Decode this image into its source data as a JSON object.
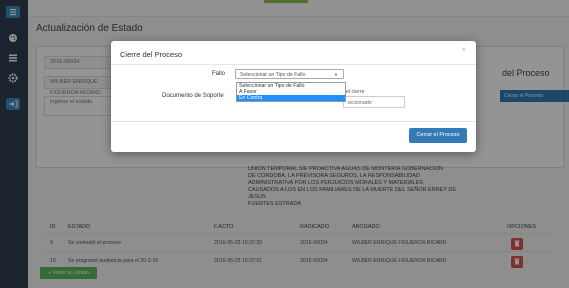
{
  "sidebar": {
    "icons": [
      "menu-icon",
      "palette-icon",
      "list-icon",
      "gear-icon",
      "sign-in-icon"
    ]
  },
  "page": {
    "title": "Actualización de Estado"
  },
  "background_form": {
    "field_1": "2016-00034",
    "field_2": "WILBER ENRIQUE FIGUEROA RICARD",
    "state_placeholder": "Ingrese el estado",
    "side_title": "del Proceso",
    "side_button": "Cerrar el Proceso"
  },
  "description": "UNION TEMPORAL SIE PROACTIVA AGUAS DE MONTERIA GOBERNACION\nDE CORDOBA, LA PREVISORA SEGUROS, LA RESPONSABILIDAD\nADMINISTRATIVA POR LOS PERJUICIOS MORALES Y MATERIALES\nCAUSADOS A LOS EN LOS FAMILIARES DE LA MUERTE DEL SEÑOR ERNEY DE JESUS\nFUERTES ESTRADA",
  "table": {
    "headers": [
      "ID",
      "ESTADO",
      "F.ACTO",
      "RADICADO",
      "ABOGADO",
      "OPCIONES"
    ],
    "rows": [
      {
        "id": "9",
        "estado": "Se contestó el proceso",
        "fecha": "2016-05-25 10:37:20",
        "radicado": "2016-00034",
        "abogado": "WILBER ENRIQUE FIGUEROA RICARD"
      },
      {
        "id": "10",
        "estado": "Se programó audiencia para el 20-2-16",
        "fecha": "2016-05-25 10:37:51",
        "radicado": "2016-00034",
        "abogado": "WILBER ENRIQUE FIGUEROA RICARD"
      }
    ]
  },
  "add_button": "+ Volver al Listado",
  "modal": {
    "title": "Cierre del Proceso",
    "close": "×",
    "fallo_label": "Fallo",
    "select_value": "Seleccionar un Tipo de Fallo",
    "options": [
      "Seleccionar un Tipo de Fallo",
      "A Favor",
      "En Contra"
    ],
    "selected_option": "En Contra",
    "doc_label": "Documento de Soporte",
    "doc_text": "el cierre",
    "doc_input": "eccionado",
    "submit_button": "Cerrar el Proceso"
  },
  "colors": {
    "sidebar": "#2f3d50",
    "primary": "#337ab7",
    "danger": "#d9534f",
    "success": "#5cb85c",
    "highlight": "#1e90ff"
  }
}
